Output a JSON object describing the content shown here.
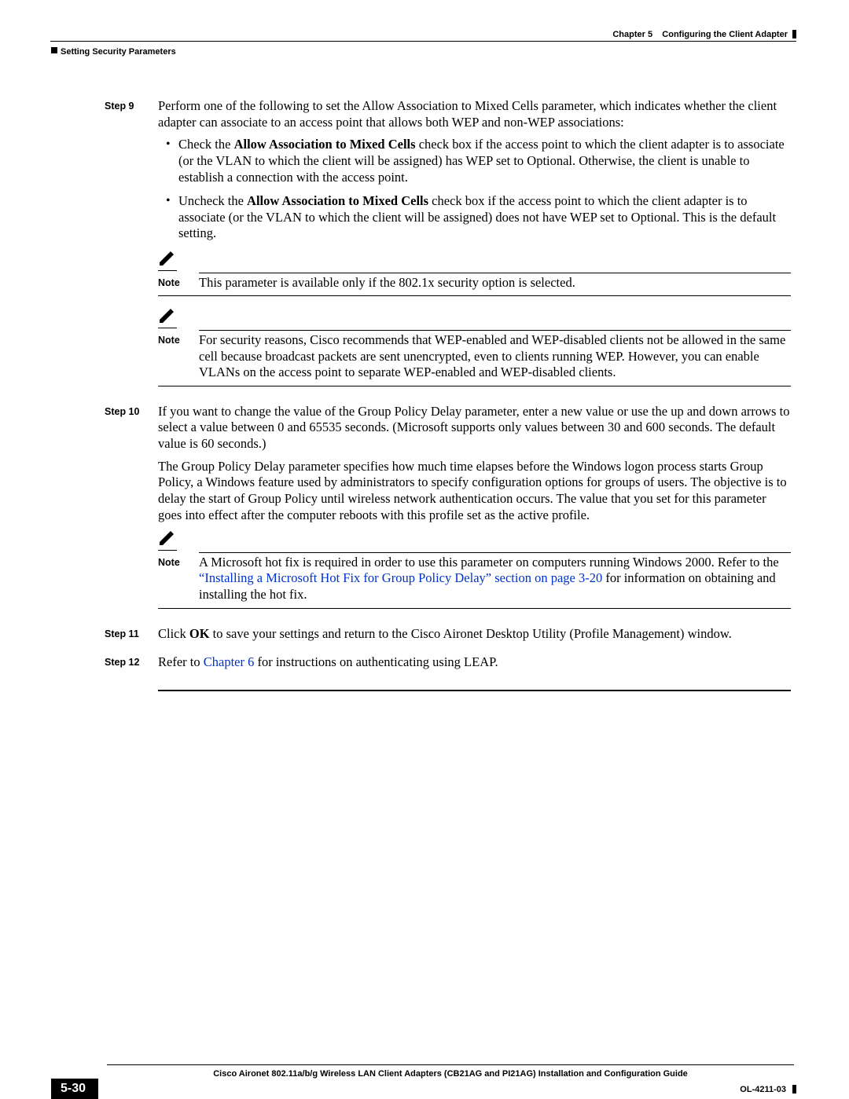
{
  "header": {
    "chapter": "Chapter 5    Configuring the Client Adapter",
    "section": "Setting Security Parameters"
  },
  "steps": {
    "s9": {
      "label": "Step 9",
      "intro": "Perform one of the following to set the Allow Association to Mixed Cells parameter, which indicates whether the client adapter can associate to an access point that allows both WEP and non-WEP associations:",
      "b1_pre": "Check the ",
      "b1_bold": "Allow Association to Mixed Cells",
      "b1_post": " check box if the access point to which the client adapter is to associate (or the VLAN to which the client will be assigned) has WEP set to Optional. Otherwise, the client is unable to establish a connection with the access point.",
      "b2_pre": "Uncheck the ",
      "b2_bold": "Allow Association to Mixed Cells",
      "b2_post": " check box if the access point to which the client adapter is to associate (or the VLAN to which the client will be assigned) does not have WEP set to Optional. This is the default setting.",
      "note1_label": "Note",
      "note1_text": "This parameter is available only if the 802.1x security option is selected.",
      "note2_label": "Note",
      "note2_text": "For security reasons, Cisco recommends that WEP-enabled and WEP-disabled clients not be allowed in the same cell because broadcast packets are sent unencrypted, even to clients running WEP. However, you can enable VLANs on the access point to separate WEP-enabled and WEP-disabled clients."
    },
    "s10": {
      "label": "Step 10",
      "p1": "If you want to change the value of the Group Policy Delay parameter, enter a new value or use the up and down arrows to select a value between 0 and 65535 seconds. (Microsoft supports only values between 30 and 600 seconds. The default value is 60 seconds.)",
      "p2": "The Group Policy Delay parameter specifies how much time elapses before the Windows logon process starts Group Policy, a Windows feature used by administrators to specify configuration options for groups of users. The objective is to delay the start of Group Policy until wireless network authentication occurs. The value that you set for this parameter goes into effect after the computer reboots with this profile set as the active profile.",
      "note_label": "Note",
      "note_pre": "A Microsoft hot fix is required in order to use this parameter on computers running Windows 2000. Refer to the ",
      "note_link": "“Installing a Microsoft Hot Fix for Group Policy Delay” section on page 3-20",
      "note_post": " for information on obtaining and installing the hot fix."
    },
    "s11": {
      "label": "Step 11",
      "pre": "Click ",
      "bold": "OK",
      "post": " to save your settings and return to the Cisco Aironet Desktop Utility (Profile Management) window."
    },
    "s12": {
      "label": "Step 12",
      "pre": "Refer to ",
      "link": "Chapter 6",
      "post": " for instructions on authenticating using LEAP."
    }
  },
  "footer": {
    "guide": "Cisco Aironet 802.11a/b/g Wireless LAN Client Adapters (CB21AG and PI21AG) Installation and Configuration Guide",
    "page": "5-30",
    "docnum": "OL-4211-03"
  }
}
